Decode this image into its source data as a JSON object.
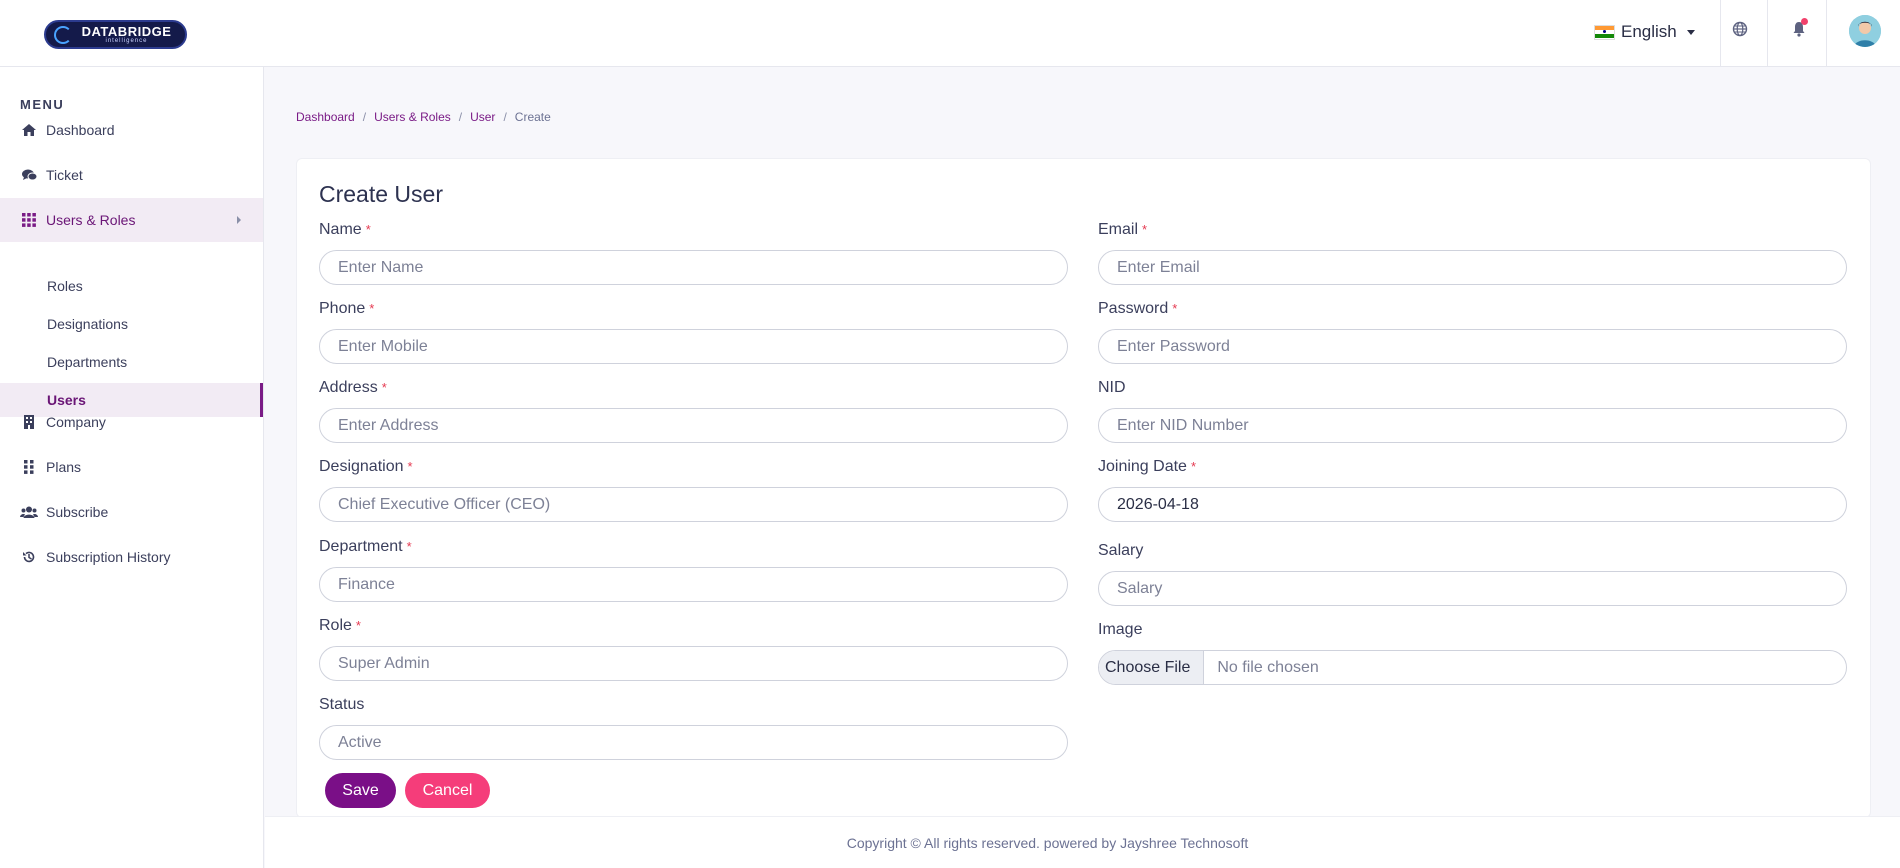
{
  "header": {
    "logo": {
      "line1": "DATABRIDGE",
      "line2": "intelligence"
    },
    "language": {
      "label": "English",
      "flag": "india-flag-icon"
    },
    "icons": [
      "globe-icon",
      "bell-icon",
      "avatar"
    ]
  },
  "sidebar": {
    "menu_title": "MENU",
    "items": [
      {
        "label": "Dashboard",
        "icon": "home-icon"
      },
      {
        "label": "Ticket",
        "icon": "chat-bubbles-icon"
      },
      {
        "label": "Users & Roles",
        "icon": "grid-icon",
        "expanded": true
      },
      {
        "label": "Company",
        "icon": "building-icon"
      },
      {
        "label": "Plans",
        "icon": "dots-grid-icon"
      },
      {
        "label": "Subscribe",
        "icon": "users-icon"
      },
      {
        "label": "Subscription History",
        "icon": "history-icon"
      }
    ],
    "subitems": [
      {
        "label": "Roles"
      },
      {
        "label": "Designations"
      },
      {
        "label": "Departments"
      },
      {
        "label": "Users",
        "active": true
      }
    ]
  },
  "breadcrumb": {
    "items": [
      "Dashboard",
      "Users & Roles",
      "User"
    ],
    "current": "Create",
    "separator": "/"
  },
  "form": {
    "title": "Create User",
    "required_mark": "*",
    "fields": {
      "name": {
        "label": "Name",
        "placeholder": "Enter Name"
      },
      "email": {
        "label": "Email",
        "placeholder": "Enter Email"
      },
      "phone": {
        "label": "Phone",
        "placeholder": "Enter Mobile"
      },
      "password": {
        "label": "Password",
        "placeholder": "Enter Password"
      },
      "address": {
        "label": "Address",
        "placeholder": "Enter Address"
      },
      "nid": {
        "label": "NID",
        "placeholder": "Enter NID Number"
      },
      "designation": {
        "label": "Designation",
        "value": "Chief Executive Officer (CEO)"
      },
      "joining_date": {
        "label": "Joining Date",
        "value": "2026-04-18"
      },
      "department": {
        "label": "Department",
        "value": "Finance"
      },
      "salary": {
        "label": "Salary",
        "placeholder": "Salary"
      },
      "role": {
        "label": "Role",
        "value": "Super Admin"
      },
      "image": {
        "label": "Image",
        "button": "Choose File",
        "status": "No file chosen"
      },
      "status": {
        "label": "Status",
        "value": "Active"
      }
    },
    "save_label": "Save",
    "cancel_label": "Cancel"
  },
  "footer": {
    "text": "Copyright © All rights reserved. powered by Jayshree Technosoft"
  },
  "colors": {
    "accent": "#7a0f87",
    "cancel": "#f53d7a",
    "active_bg": "#f2ebf4"
  }
}
